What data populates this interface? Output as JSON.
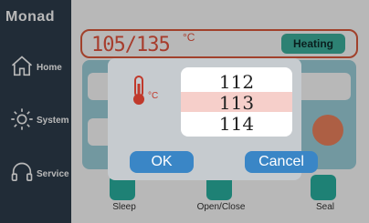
{
  "brand": "Monad",
  "sidebar": {
    "items": [
      {
        "label": "Home",
        "icon": "home-icon"
      },
      {
        "label": "System",
        "icon": "gear-icon"
      },
      {
        "label": "Service",
        "icon": "headset-icon"
      }
    ]
  },
  "header": {
    "temperature": "105/135",
    "unit": "°C",
    "status": "Heating"
  },
  "actions": [
    {
      "label": "Sleep",
      "icon": "sleep-icon"
    },
    {
      "label": "Open/Close",
      "icon": "open-close-icon"
    },
    {
      "label": "Seal",
      "icon": "seal-icon"
    }
  ],
  "dialog": {
    "unit": "°C",
    "picker": {
      "prev": "112",
      "current": "113",
      "next": "114"
    },
    "ok_label": "OK",
    "cancel_label": "Cancel"
  },
  "colors": {
    "sidebar": "#2e3e4d",
    "accent_red": "#e8553f",
    "accent_teal": "#3fb3a0",
    "dialog_button": "#3a86c6",
    "picker_highlight": "#f6cfca"
  }
}
